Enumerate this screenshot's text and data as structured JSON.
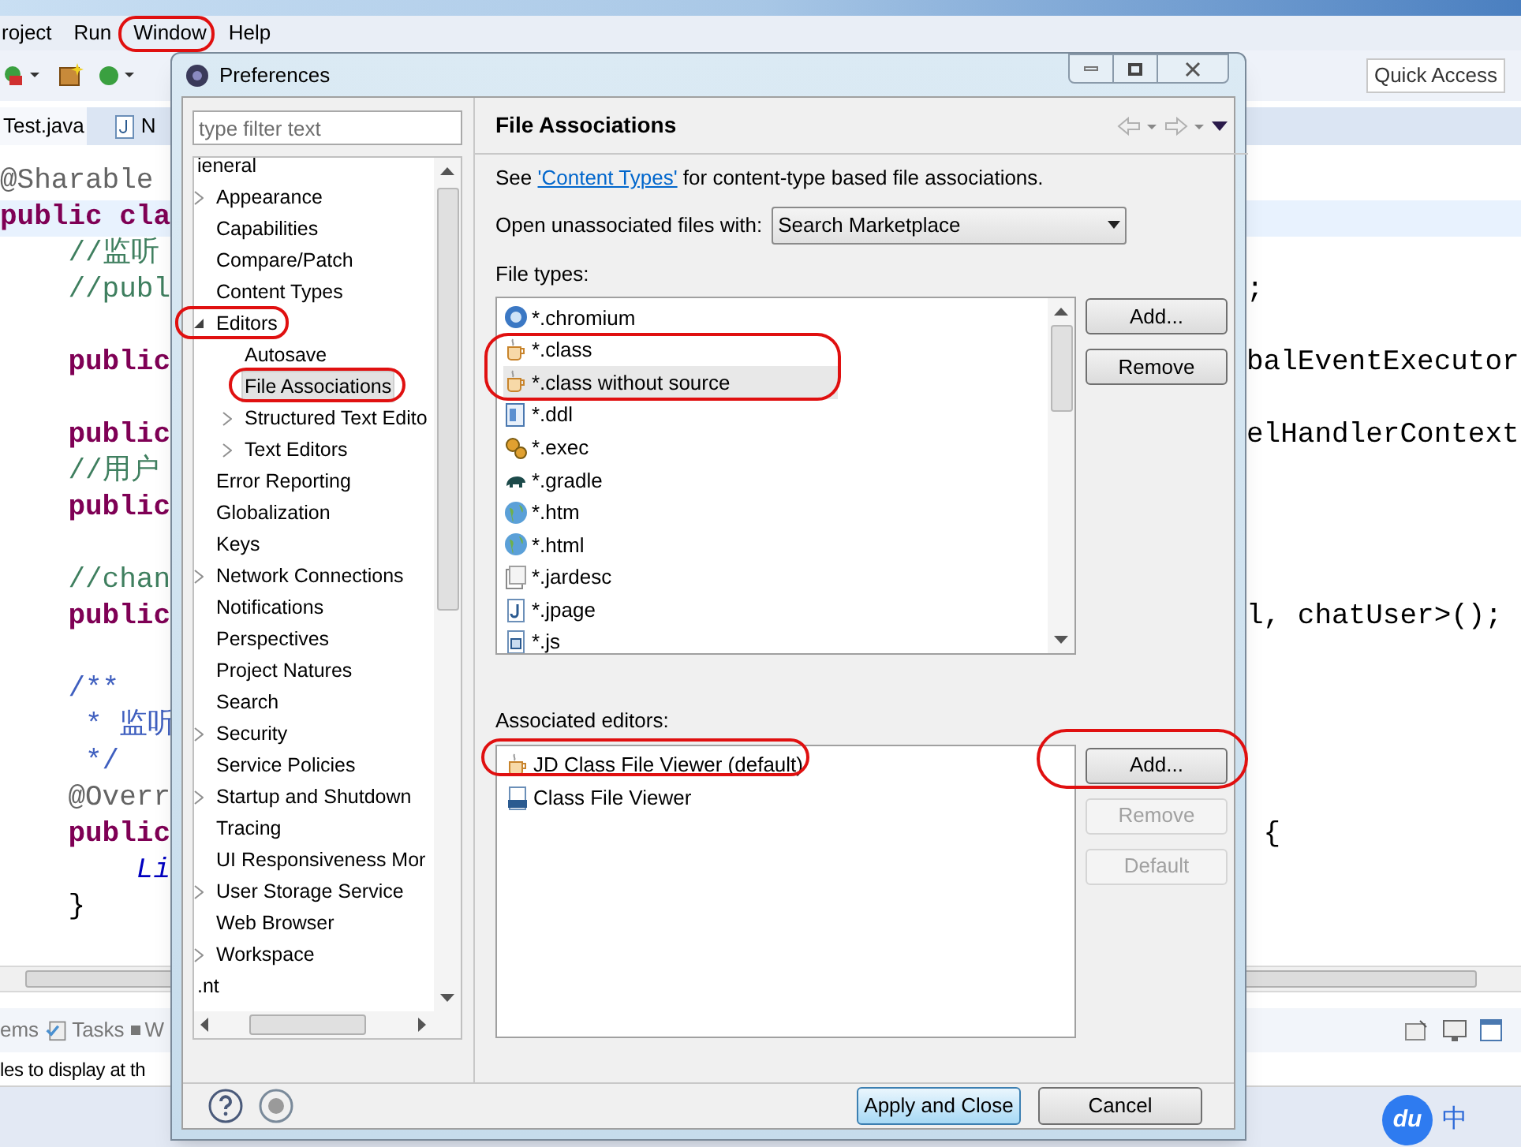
{
  "ide": {
    "menu": [
      "roject",
      "Run",
      "Window",
      "Help"
    ],
    "quick_access": "Quick Access",
    "editor_tabs": [
      {
        "label": "Test.java",
        "selected": true
      },
      {
        "label": "N",
        "selected": false
      }
    ],
    "code_lines": [
      {
        "kind": "annotation",
        "left": "@Sharable",
        "highlighted": false
      },
      {
        "kind": "keyword",
        "left": "public cla",
        "highlighted": true
      },
      {
        "kind": "comment",
        "left": "    //监听",
        "highlighted": false
      },
      {
        "kind": "comment",
        "left": "    //publ",
        "right": ";",
        "highlighted": false
      },
      {
        "kind": "blank",
        "highlighted": false
      },
      {
        "kind": "keyword",
        "left": "    public",
        "right": "balEventExecutor",
        "highlighted": false
      },
      {
        "kind": "blank",
        "highlighted": false
      },
      {
        "kind": "keyword",
        "left": "    public",
        "right": "elHandlerContext",
        "highlighted": false
      },
      {
        "kind": "comment",
        "left": "    //用户",
        "highlighted": false
      },
      {
        "kind": "keyword",
        "left": "    public",
        "highlighted": false
      },
      {
        "kind": "blank",
        "highlighted": false
      },
      {
        "kind": "comment",
        "left": "    //chan",
        "highlighted": false
      },
      {
        "kind": "keyword",
        "left": "    public",
        "right": "l, chatUser>();",
        "highlighted": false
      },
      {
        "kind": "blank",
        "highlighted": false
      },
      {
        "kind": "javadoc",
        "left": "    /**",
        "highlighted": false
      },
      {
        "kind": "javadoc",
        "left": "     * 监听",
        "highlighted": false
      },
      {
        "kind": "javadoc",
        "left": "     */",
        "highlighted": false
      },
      {
        "kind": "annotation",
        "left": "    @Overr",
        "highlighted": false
      },
      {
        "kind": "keyword",
        "left": "    public",
        "right": " {",
        "highlighted": false
      },
      {
        "kind": "type",
        "left": "        Li",
        "highlighted": false
      },
      {
        "kind": "plain",
        "left": "    }",
        "highlighted": false
      }
    ],
    "panel_tabs": [
      {
        "label": "ems",
        "selected": false
      },
      {
        "label": "Tasks",
        "selected": false
      },
      {
        "label": "W",
        "selected": false
      }
    ],
    "panel_text": "les to display at th",
    "ime": {
      "logo": "du",
      "mode": "中"
    }
  },
  "dialog": {
    "title": "Preferences",
    "filter": {
      "placeholder": "type filter text"
    },
    "tree": [
      {
        "label": "ieneral",
        "selected": false,
        "children": [
          {
            "label": "Appearance",
            "selected": false,
            "expanded": false
          },
          {
            "label": "Capabilities",
            "selected": false
          },
          {
            "label": "Compare/Patch",
            "selected": false
          },
          {
            "label": "Content Types",
            "selected": false
          },
          {
            "label": "Editors",
            "selected": false,
            "expanded": true,
            "children": [
              {
                "label": "Autosave",
                "selected": false
              },
              {
                "label": "File Associations",
                "selected": true
              },
              {
                "label": "Structured Text Edito",
                "selected": false,
                "expanded": false
              },
              {
                "label": "Text Editors",
                "selected": false,
                "expanded": false
              }
            ]
          },
          {
            "label": "Error Reporting",
            "selected": false
          },
          {
            "label": "Globalization",
            "selected": false
          },
          {
            "label": "Keys",
            "selected": false
          },
          {
            "label": "Network Connections",
            "selected": false,
            "expanded": false
          },
          {
            "label": "Notifications",
            "selected": false
          },
          {
            "label": "Perspectives",
            "selected": false
          },
          {
            "label": "Project Natures",
            "selected": false
          },
          {
            "label": "Search",
            "selected": false
          },
          {
            "label": "Security",
            "selected": false,
            "expanded": false
          },
          {
            "label": "Service Policies",
            "selected": false
          },
          {
            "label": "Startup and Shutdown",
            "selected": false,
            "expanded": false
          },
          {
            "label": "Tracing",
            "selected": false
          },
          {
            "label": "UI Responsiveness Mor",
            "selected": false
          },
          {
            "label": "User Storage Service",
            "selected": false,
            "expanded": false
          },
          {
            "label": "Web Browser",
            "selected": false
          },
          {
            "label": "Workspace",
            "selected": false,
            "expanded": false
          }
        ]
      },
      {
        "label": ".nt",
        "selected": false
      }
    ],
    "page_title": "File Associations",
    "intro": {
      "before": "See ",
      "link": "'Content Types'",
      "after": " for content-type based file associations."
    },
    "open_with": {
      "label": "Open unassociated files with:",
      "value": "Search Marketplace"
    },
    "file_types_label": "File types:",
    "file_types": [
      {
        "label": "*.chromium",
        "kind": "browser",
        "selected": false
      },
      {
        "label": "*.class",
        "kind": "cup",
        "selected": false
      },
      {
        "label": "*.class without source",
        "kind": "cup",
        "selected": true
      },
      {
        "label": "*.ddl",
        "kind": "table",
        "selected": false
      },
      {
        "label": "*.exec",
        "kind": "gears",
        "selected": false
      },
      {
        "label": "*.gradle",
        "kind": "elephant",
        "selected": false
      },
      {
        "label": "*.htm",
        "kind": "globe",
        "selected": false
      },
      {
        "label": "*.html",
        "kind": "globe",
        "selected": false
      },
      {
        "label": "*.jardesc",
        "kind": "jar",
        "selected": false
      },
      {
        "label": "*.jpage",
        "kind": "java",
        "selected": false
      },
      {
        "label": "*.js",
        "kind": "script",
        "selected": false
      }
    ],
    "file_type_buttons": [
      {
        "label": "Add...",
        "disabled": false
      },
      {
        "label": "Remove",
        "disabled": false
      }
    ],
    "editors_label": "Associated editors:",
    "editors": [
      {
        "label": "JD Class File Viewer (default)",
        "kind": "cup"
      },
      {
        "label": "Class File Viewer",
        "kind": "binary"
      }
    ],
    "editor_buttons": [
      {
        "label": "Add...",
        "disabled": false
      },
      {
        "label": "Remove",
        "disabled": true
      },
      {
        "label": "Default",
        "disabled": true
      }
    ],
    "footer_buttons": [
      {
        "label": "Apply and Close",
        "kind": "primary"
      },
      {
        "label": "Cancel",
        "kind": "normal"
      }
    ]
  }
}
